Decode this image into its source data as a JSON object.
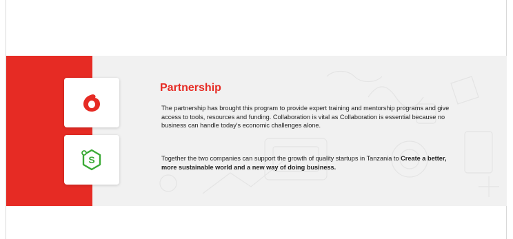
{
  "section": {
    "title": "Partnership",
    "paragraph1": "The partnership has brought this program to provide expert training and mentorship programs and give access to tools, resources and funding. Collaboration is vital as Collaboration is essential because no business can handle today's economic challenges alone.",
    "paragraph2_lead": "Together the two companies can support the growth of quality startups in Tanzania to",
    "paragraph2_bold": "Create a better, more sustainable world and a new way of doing business."
  },
  "logos": [
    {
      "icon": "vodafone-logo-icon",
      "color": "#e62b24"
    },
    {
      "icon": "startup-hexagon-logo-icon",
      "color": "#3aaa35"
    }
  ],
  "colors": {
    "accent_red": "#e62b24",
    "band_background": "#f1f1f1",
    "text": "#222222"
  }
}
